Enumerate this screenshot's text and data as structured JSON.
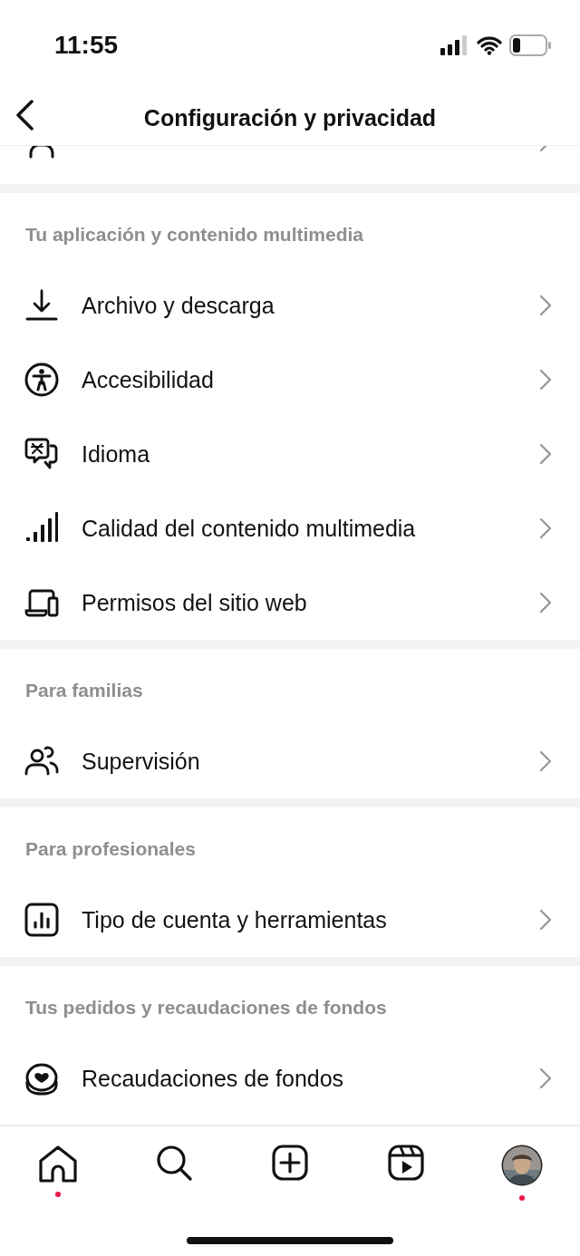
{
  "status_bar": {
    "time": "11:55"
  },
  "header": {
    "title": "Configuración y privacidad"
  },
  "sections": [
    {
      "title": "Tu aplicación y contenido multimedia",
      "items": [
        {
          "label": "Archivo y descarga"
        },
        {
          "label": "Accesibilidad"
        },
        {
          "label": "Idioma"
        },
        {
          "label": "Calidad del contenido multimedia"
        },
        {
          "label": "Permisos del sitio web"
        }
      ]
    },
    {
      "title": "Para familias",
      "items": [
        {
          "label": "Supervisión"
        }
      ]
    },
    {
      "title": "Para profesionales",
      "items": [
        {
          "label": "Tipo de cuenta y herramientas"
        }
      ]
    },
    {
      "title": "Tus pedidos y recaudaciones de fondos",
      "items": [
        {
          "label": "Recaudaciones de fondos"
        }
      ]
    }
  ],
  "tabs": [
    {
      "kind": "home",
      "notification": true
    },
    {
      "kind": "search",
      "notification": false
    },
    {
      "kind": "create",
      "notification": false
    },
    {
      "kind": "reels",
      "notification": false
    },
    {
      "kind": "profile",
      "notification": true
    }
  ]
}
